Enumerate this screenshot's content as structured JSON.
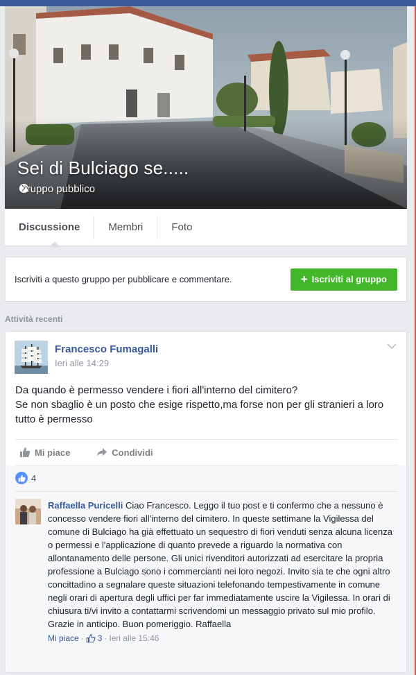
{
  "group": {
    "title": "Sei di Bulciago se.....",
    "privacy": "Gruppo pubblico"
  },
  "tabs": [
    {
      "label": "Discussione"
    },
    {
      "label": "Membri"
    },
    {
      "label": "Foto"
    }
  ],
  "join": {
    "text": "Iscriviti a questo gruppo per pubblicare e commentare.",
    "button": "Iscriviti al gruppo"
  },
  "recent_label": "Attività recenti",
  "post": {
    "author": "Francesco Fumagalli",
    "time": "Ieri alle 14:29",
    "line1": "Da quando è permesso vendere i fiori all'interno del cimitero?",
    "line2": "Se non sbaglio è un posto che esige rispetto,ma forse non per gli stranieri a loro tutto è permesso",
    "like_label": "Mi piace",
    "share_label": "Condividi",
    "like_count": "4"
  },
  "comment": {
    "author": "Raffaella Puricelli",
    "text": "Ciao Francesco. Leggo il tuo post e ti confermo che a nessuno è concesso vendere fiori all'interno del cimitero. In queste settimane la Vigilessa del comune di Bulciago ha già effettuato un sequestro di fiori venduti senza alcuna licenza o permessi e l'applicazione di quanto prevede a riguardo la normativa con allontanamento delle persone. Gli unici rivenditori autorizzati ad esercitare la propria professione a Bulciago sono i commercianti nei loro negozi. Invito sia te che ogni altro concittadino a segnalare queste situazioni telefonando tempestivamente in comune negli orari di apertura degli uffici per far immediatamente uscire la Vigilessa. In orari di chiusura ti/vi invito a contattarmi scrivendomi un messaggio privato sul mio profilo. Grazie in anticipo. Buon pomeriggio. Raffaella",
    "like_label": "Mi piace",
    "dot1": "·",
    "likes": "3",
    "dot2": "·",
    "time": "Ieri alle 15:46"
  },
  "colors": {
    "brand": "#3b5998",
    "link": "#365899",
    "join_button": "#42b72a"
  }
}
